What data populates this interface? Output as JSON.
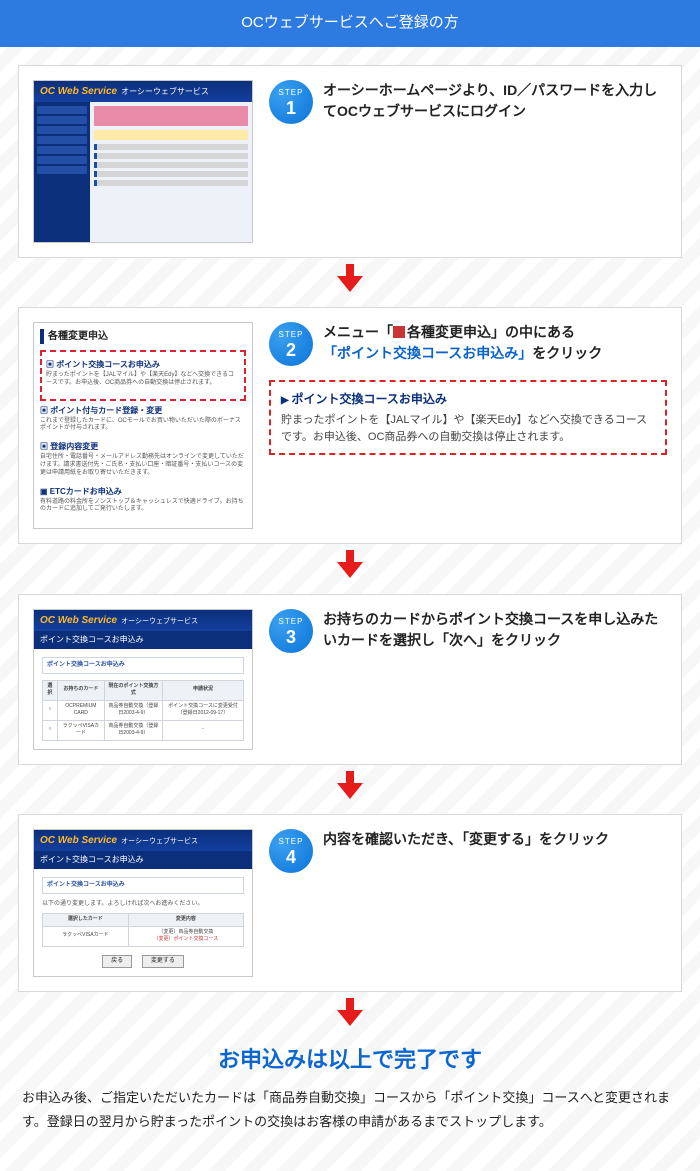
{
  "banner_title": "OCウェブサービスへご登録の方",
  "step_label": "STEP",
  "steps": {
    "s1": {
      "num": "1",
      "text": "オーシーホームページより、ID／パスワードを入力してOCウェブサービスにログイン"
    },
    "s2": {
      "num": "2",
      "text_before": "メニュー「",
      "text_box_label": "各種変更申込",
      "text_mid": "」の中にある",
      "text_link": "「ポイント交換コースお申込み」",
      "text_after": "をクリック",
      "callout_title": "ポイント交換コースお申込み",
      "callout_body": "貯まったポイントを【JALマイル】や【楽天Edy】などへ交換できるコースです。お申込後、OC商品券への自動交換は停止されます。"
    },
    "s3": {
      "num": "3",
      "text": "お持ちのカードからポイント交換コースを申し込みたいカードを選択し「次へ」をクリック"
    },
    "s4": {
      "num": "4",
      "text": "内容を確認いただき、「変更する」をクリック"
    }
  },
  "thumb_common": {
    "brand": "OC Web Service",
    "brand_sub": "オーシーウェブサービス"
  },
  "thumb2": {
    "menu_title": "各種変更申込",
    "items": [
      {
        "hd": "ポイント交換コースお申込み",
        "bd": "貯まったポイントを【JALマイル】や【楽天Edy】などへ交換できるコースです。お申込後、OC商品券への自動交換は停止されます。"
      },
      {
        "hd": "ポイント付与カード登録・変更",
        "bd": "これまで登録したカードに、OCモールでお買い物いただいた際のボーナスポイントが付与されます。"
      },
      {
        "hd": "登録内容変更",
        "bd": "自宅住所・電話番号・メールアドレス勤務先はオンラインで変更していただけます。請求書送付先・ご氏名・支払い口座・暗証番号・支払いコースの変更は申請用紙をお取り寄せいただきます。"
      },
      {
        "hd": "ETCカードお申込み",
        "bd": "有料道路の料金所をノンストップ＆キャッシュレスで快適ドライブ。お持ちのカードに追加してご発行いたします。"
      }
    ]
  },
  "thumb3": {
    "subhead": "ポイント交換コースお申込み",
    "box_title": "ポイント交換コースお申込み",
    "cols": [
      "選択",
      "お持ちのカード",
      "現在のポイント交換方式",
      "申請状況"
    ],
    "rows": [
      [
        "○",
        "OCPREMIUM CARD",
        "商品券自動交換（登録日2003-4-9）",
        "ポイント交換コースに変更受付（登録日2012-09-17）"
      ],
      [
        "○",
        "ラクッペVISAカード",
        "商品券自動交換（登録日2003-4-9）",
        "-"
      ]
    ]
  },
  "thumb4": {
    "subhead": "ポイント交換コースお申込み",
    "box_title": "ポイント交換コースお申込み",
    "lead": "以下の通り変更します。よろしければ次へお進みください。",
    "cols": [
      "選択したカード",
      "変更内容"
    ],
    "row_card": "ラクッペVISAカード",
    "row_change_before": "（変更）商品券自動交換",
    "row_change_after": "（変更）ポイント交換コース",
    "btn_back": "戻る",
    "btn_submit": "変更する"
  },
  "finish": {
    "title": "お申込みは以上で完了です",
    "body": "お申込み後、ご指定いただいたカードは「商品券自動交換」コースから「ポイント交換」コースへと変更されます。登録日の翌月から貯まったポイントの交換はお客様の申請があるまでストップします。"
  }
}
